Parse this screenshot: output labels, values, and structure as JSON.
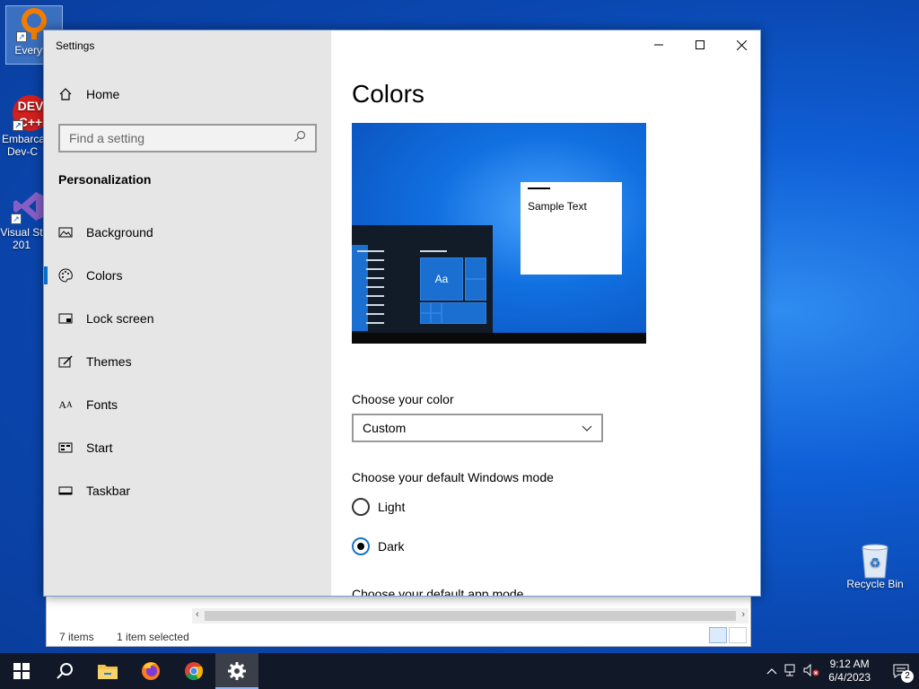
{
  "desktop": {
    "icons": [
      {
        "label": "Everythi",
        "name": "everything-icon"
      },
      {
        "label": "Embarca Dev-C",
        "name": "dev-cpp-icon"
      },
      {
        "label": "Visual St 201",
        "name": "visual-studio-icon"
      },
      {
        "label": "Recycle Bin",
        "name": "recycle-bin-icon"
      }
    ]
  },
  "explorer": {
    "status_items": "7 items",
    "status_selected": "1 item selected"
  },
  "settings": {
    "window_title": "Settings",
    "home_label": "Home",
    "search_placeholder": "Find a setting",
    "section_title": "Personalization",
    "nav_items": [
      {
        "label": "Background",
        "icon": "image-icon"
      },
      {
        "label": "Colors",
        "icon": "palette-icon"
      },
      {
        "label": "Lock screen",
        "icon": "lock-screen-icon"
      },
      {
        "label": "Themes",
        "icon": "themes-icon"
      },
      {
        "label": "Fonts",
        "icon": "fonts-icon"
      },
      {
        "label": "Start",
        "icon": "start-icon"
      },
      {
        "label": "Taskbar",
        "icon": "taskbar-icon"
      }
    ],
    "active_nav": "Colors",
    "page_title": "Colors",
    "preview": {
      "sample_text": "Sample Text",
      "tile_text": "Aa"
    },
    "choose_color_label": "Choose your color",
    "choose_color_value": "Custom",
    "windows_mode_label": "Choose your default Windows mode",
    "windows_mode_options": [
      "Light",
      "Dark"
    ],
    "windows_mode_selected": "Dark",
    "app_mode_label": "Choose your default app mode"
  },
  "taskbar": {
    "pinned": [
      "start-icon",
      "search-icon",
      "file-explorer-icon",
      "firefox-icon",
      "chrome-icon",
      "settings-icon"
    ],
    "clock_time": "9:12 AM",
    "clock_date": "6/4/2023",
    "notification_count": "2"
  },
  "colors": {
    "accent": "#0a6ec8",
    "sidebar_bg": "#e6e6e6",
    "taskbar_bg": "#111827"
  }
}
